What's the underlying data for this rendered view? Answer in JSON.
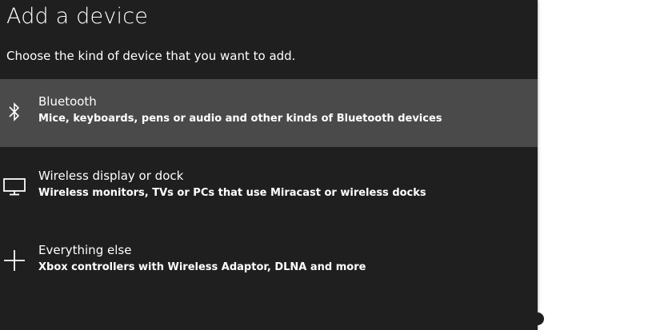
{
  "dialog": {
    "title": "Add a device",
    "subtitle": "Choose the kind of device that you want to add.",
    "options": [
      {
        "icon": "bluetooth-icon",
        "title": "Bluetooth",
        "description": "Mice, keyboards, pens or audio and other kinds of Bluetooth devices",
        "selected": true
      },
      {
        "icon": "monitor-icon",
        "title": "Wireless display or dock",
        "description": "Wireless monitors, TVs or PCs that use Miracast or wireless docks",
        "selected": false
      },
      {
        "icon": "plus-icon",
        "title": "Everything else",
        "description": "Xbox controllers with Wireless Adaptor, DLNA and more",
        "selected": false
      }
    ]
  },
  "colors": {
    "dialog_background": "#1f1f1f",
    "selected_background": "#4a4a4a",
    "text": "#ffffff",
    "page_background": "#ffffff"
  }
}
